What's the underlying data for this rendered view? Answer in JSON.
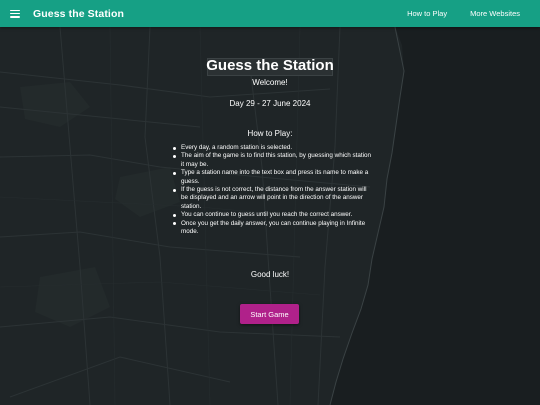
{
  "app": {
    "title": "Guess the Station",
    "brand_color": "#16a085",
    "accent_color": "#b0218a"
  },
  "nav": {
    "how_to_play": "How to Play",
    "more_websites": "More Websites"
  },
  "modal": {
    "title": "Guess the Station",
    "welcome": "Welcome!",
    "day": "Day 29 - 27 June 2024",
    "howto_heading": "How to Play:",
    "rules": [
      "Every day, a random station is selected.",
      "The aim of the game is to find this station, by guessing which station it may be.",
      "Type a station name into the text box and press its name to make a guess.",
      "If the guess is not correct, the distance from the answer station will be displayed and an arrow will point in the direction of the answer station.",
      "You can continue to guess until you reach the correct answer.",
      "Once you get the daily answer, you can continue playing in Infinite mode."
    ],
    "good_luck": "Good luck!",
    "start_button": "Start Game"
  },
  "icons": {
    "menu": "hamburger-menu-icon"
  }
}
